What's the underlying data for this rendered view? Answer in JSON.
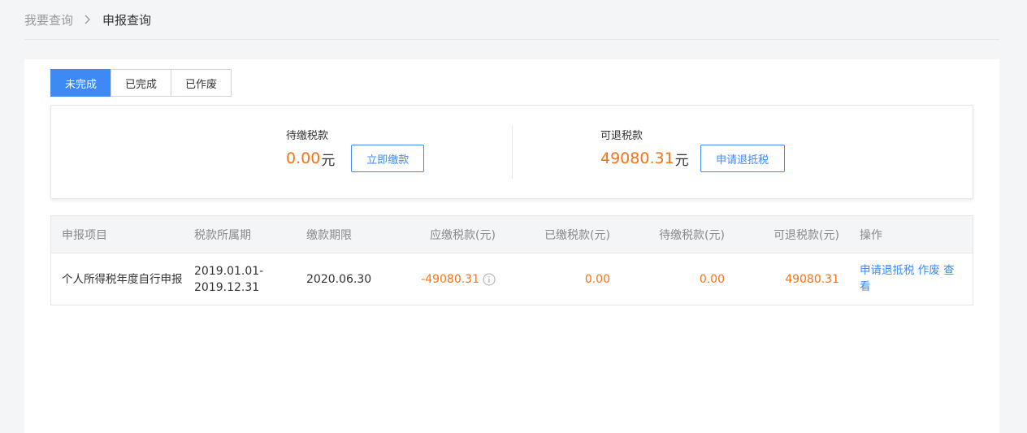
{
  "breadcrumb": {
    "parent": "我要查询",
    "current": "申报查询"
  },
  "tabs": [
    {
      "label": "未完成",
      "active": true
    },
    {
      "label": "已完成",
      "active": false
    },
    {
      "label": "已作废",
      "active": false
    }
  ],
  "summary": {
    "pending": {
      "label": "待缴税款",
      "amount": "0.00",
      "unit": "元",
      "button": "立即缴款"
    },
    "refundable": {
      "label": "可退税款",
      "amount": "49080.31",
      "unit": "元",
      "button": "申请退抵税"
    }
  },
  "table": {
    "columns": [
      "申报项目",
      "税款所属期",
      "缴款期限",
      "应缴税款(元)",
      "已缴税款(元)",
      "待缴税款(元)",
      "可退税款(元)",
      "操作"
    ],
    "rows": [
      {
        "item": "个人所得税年度自行申报",
        "period_start": "2019.01.01-",
        "period_end": "2019.12.31",
        "deadline": "2020.06.30",
        "payable": "-49080.31",
        "paid": "0.00",
        "pending": "0.00",
        "refundable": "49080.31",
        "actions": [
          "申请退抵税",
          "作废",
          "查看"
        ]
      }
    ]
  },
  "colors": {
    "accent": "#3d8af7",
    "amount": "#f97316"
  },
  "icons": {
    "breadcrumb_separator": "chevron-right-icon",
    "payable_info": "info-icon"
  }
}
